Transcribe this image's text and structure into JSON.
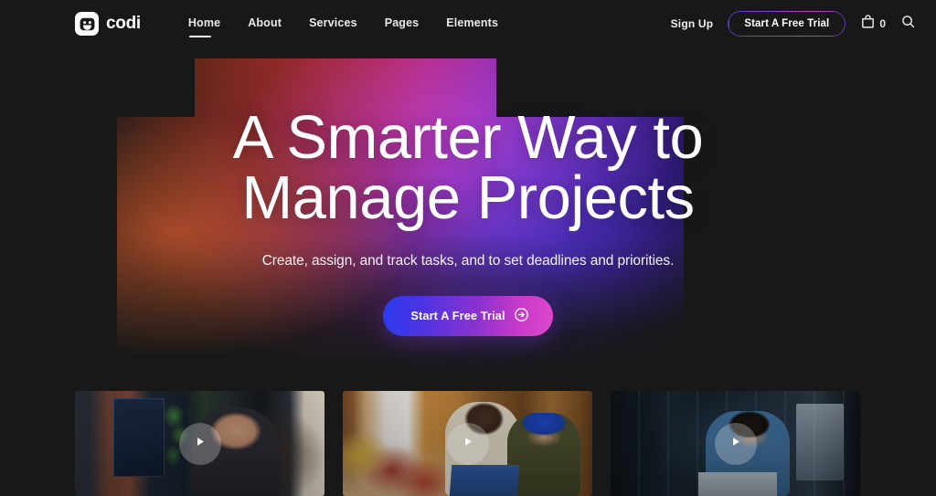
{
  "brand": {
    "name": "codi",
    "logo_icon": "robot-smiley-logo-icon"
  },
  "nav": {
    "links": [
      {
        "label": "Home",
        "active": true
      },
      {
        "label": "About",
        "active": false
      },
      {
        "label": "Services",
        "active": false
      },
      {
        "label": "Pages",
        "active": false
      },
      {
        "label": "Elements",
        "active": false
      }
    ],
    "signup_label": "Sign Up",
    "cta_label": "Start A Free Trial",
    "cart_icon": "shopping-bag-icon",
    "cart_count": "0",
    "search_icon": "search-icon"
  },
  "hero": {
    "title_line1": "A Smarter Way to",
    "title_line2": "Manage Projects",
    "subtitle": "Create, assign, and track tasks, and to set deadlines and priorities.",
    "cta_label": "Start A Free Trial",
    "cta_icon": "arrow-right-circle-icon",
    "gradient_colors": {
      "orange": "#F0521C",
      "red": "#E8401F",
      "magenta": "#B52A76",
      "purple": "#8B2BA6",
      "violet": "#5B2AB0",
      "deep_blue": "#2E1C78"
    }
  },
  "cards": [
    {
      "alt": "Smiling woman at desk in brick-wall office with monitors",
      "play_icon": "play-icon"
    },
    {
      "alt": "Two people laughing on a couch while looking at a laptop",
      "play_icon": "play-icon"
    },
    {
      "alt": "Man in blue shirt working on a laptop in a dark modern office",
      "play_icon": "play-icon"
    }
  ],
  "theme": {
    "background": "#181818",
    "text": "#ffffff",
    "cta_gradient_start": "#2B3BEF",
    "cta_gradient_end": "#DC49C9"
  }
}
